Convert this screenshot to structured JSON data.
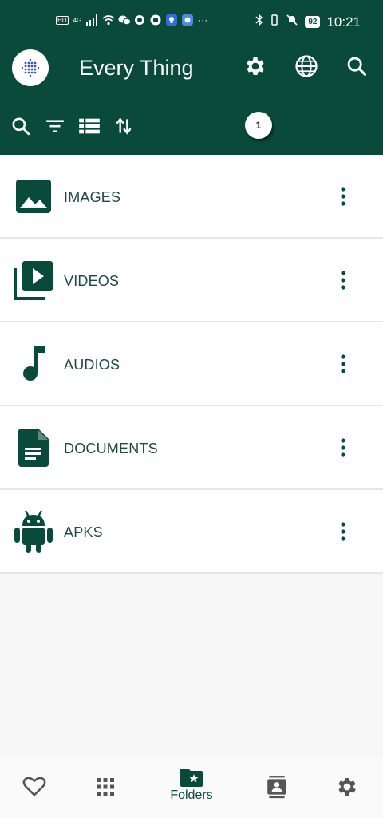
{
  "status": {
    "left_icons": [
      "hd-icon",
      "signal-icon",
      "wifi-icon",
      "wechat-icon",
      "notification-icon",
      "android-icon",
      "bulb-icon",
      "app-icon",
      "more-icon"
    ],
    "hd": "HD",
    "network": "4G",
    "more": "···",
    "battery": "92",
    "time": "10:21"
  },
  "app": {
    "title": "Every Thing",
    "badge_count": "1"
  },
  "colors": {
    "primary": "#0a4a3a",
    "text": "#1f4a40"
  },
  "categories": [
    {
      "label": "IMAGES",
      "icon": "image-icon"
    },
    {
      "label": "VIDEOS",
      "icon": "video-library-icon"
    },
    {
      "label": "AUDIOS",
      "icon": "music-note-icon"
    },
    {
      "label": "DOCUMENTS",
      "icon": "document-icon"
    },
    {
      "label": "APKS",
      "icon": "android-icon"
    }
  ],
  "bottom_nav": {
    "active": "Folders",
    "items": [
      {
        "icon": "heart-icon",
        "label": ""
      },
      {
        "icon": "grid-icon",
        "label": ""
      },
      {
        "icon": "folder-star-icon",
        "label": "Folders"
      },
      {
        "icon": "contacts-icon",
        "label": ""
      },
      {
        "icon": "gear-icon",
        "label": ""
      }
    ]
  }
}
